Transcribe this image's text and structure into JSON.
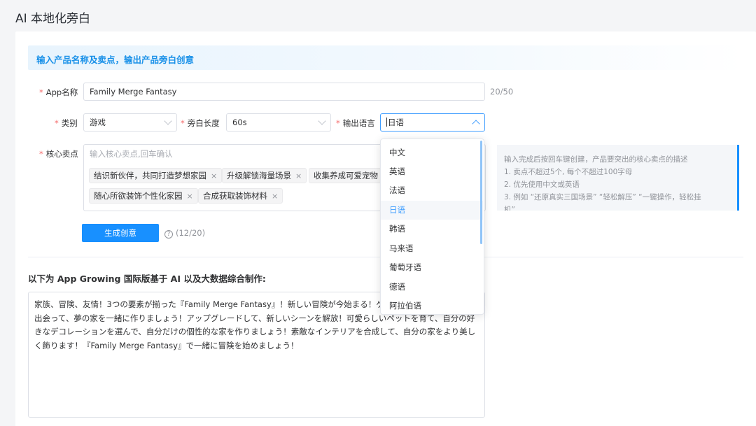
{
  "page": {
    "title": "AI 本地化旁白"
  },
  "banner": {
    "text": "输入产品名称及卖点，输出产品旁白创意"
  },
  "form": {
    "app_name": {
      "label": "App名称",
      "required": "*",
      "value": "Family Merge Fantasy",
      "counter": "20/50"
    },
    "category": {
      "label": "类别",
      "required": "*",
      "value": "游戏"
    },
    "length": {
      "label": "旁白长度",
      "required": "*",
      "value": "60s"
    },
    "language": {
      "label": "输出语言",
      "required": "*",
      "value": "日语"
    },
    "selling_points": {
      "label": "核心卖点",
      "required": "*",
      "placeholder": "输入核心卖点,回车确认",
      "tags": [
        "结识新伙伴，共同打造梦想家园",
        "升级解锁海量场景",
        "收集养成可爱宠物",
        "随心所欲装饰个性化家园",
        "合成获取装饰材料"
      ],
      "tag_close": "×"
    },
    "generate_button": "生成创意",
    "help_icon": "?",
    "usage": "(12/20)"
  },
  "hint": {
    "lines": [
      "输入完成后按回车键创建，产品要突出的核心卖点的描述",
      "1. 卖点不超过5个, 每个不超过100字母",
      "2. 优先使用中文或英语",
      "3. 例如 “还原真实三国场景” “轻松解压” “一键操作，轻松挂",
      "机”"
    ]
  },
  "result": {
    "title": "以下为 App Growing 国际版基于 AI 以及大数据综合制作:",
    "text": "家族、冒険、友情！3つの要素が揃った『Family Merge Fantasy』！新しい冒険が今始まる！ゲームの中で新しい仲間と出会って、夢の家を一緒に作りましょう！アップグレードして、新しいシーンを解放！可愛らしいペットを育て、自分の好きなデコレーションを選んで、自分だけの個性的な家を作りましょう！素敵なインテリアを合成して、自分の家をより美しく飾ります！『Family Merge Fantasy』で一緒に冒険を始めましょう！"
  },
  "dropdown": {
    "options": [
      "中文",
      "英语",
      "法语",
      "日语",
      "韩语",
      "马来语",
      "葡萄牙语",
      "德语",
      "阿拉伯语"
    ],
    "selected": "日语"
  },
  "colors": {
    "accent": "#1890ff",
    "required": "#f56c6c",
    "banner_text": "#1890e8"
  }
}
